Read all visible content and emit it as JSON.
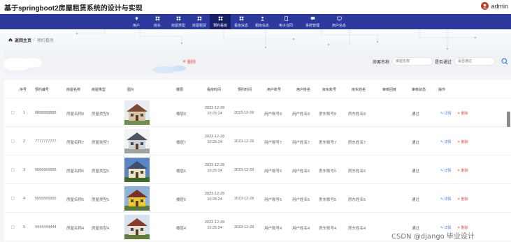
{
  "app": {
    "title": "基于springboot2房屋租赁系统的设计与实现",
    "user": "admin"
  },
  "nav": {
    "items": [
      {
        "label": "用户",
        "icon": "user-icon"
      },
      {
        "label": "房东",
        "icon": "grid-icon"
      },
      {
        "label": "房屋类型",
        "icon": "grid-icon"
      },
      {
        "label": "房屋租赁",
        "icon": "grid-icon"
      },
      {
        "label": "预约看房",
        "icon": "grid-icon",
        "active": true
      },
      {
        "label": "看房信息",
        "icon": "grid-icon"
      },
      {
        "label": "租房信息",
        "icon": "person-icon"
      },
      {
        "label": "电子合同",
        "icon": "doc-icon"
      },
      {
        "label": "系统管理",
        "icon": "chat-icon"
      },
      {
        "label": "用户信息",
        "icon": "monitor-icon"
      }
    ]
  },
  "breadcrumb": {
    "home": "返回主页",
    "current": "预约看房"
  },
  "toolbar": {
    "delete_label": "删除"
  },
  "filters": [
    {
      "label": "房屋名称",
      "placeholder": "房屋名称"
    },
    {
      "label": "是否通过",
      "placeholder": "是否通过"
    }
  ],
  "table": {
    "columns": [
      "序号",
      "预约编号",
      "房屋名称",
      "房屋类型",
      "图片",
      "楼层",
      "看房时间",
      "预约时间",
      "用户账号",
      "用户姓名",
      "房东账号",
      "房东姓名",
      "审核回复",
      "审核状态",
      "操作"
    ],
    "actions": {
      "detail": "详情",
      "delete": "删除"
    },
    "rows": [
      {
        "index": "1",
        "code": "8888888888",
        "name": "房屋名称8",
        "type": "房屋类型8",
        "floor": "楼层8",
        "date": "2023-12-28",
        "time": "10:25:24",
        "booked": "2023-12-28",
        "account": "用户账号8",
        "username": "用户姓名8",
        "landlord_account": "房东账号8",
        "landlord_name": "房东姓名8",
        "reply": "",
        "status": "通过"
      },
      {
        "index": "2",
        "code": "7777777777",
        "name": "房屋名称7",
        "type": "房屋类型7",
        "floor": "楼层7",
        "date": "2023-12-28",
        "time": "10:25:24",
        "booked": "2023-12-28",
        "account": "用户账号7",
        "username": "用户姓名7",
        "landlord_account": "房东账号7",
        "landlord_name": "房东姓名7",
        "reply": "",
        "status": "通过"
      },
      {
        "index": "3",
        "code": "6666666666",
        "name": "房屋名称6",
        "type": "房屋类型6",
        "floor": "楼层6",
        "date": "2023-12-28",
        "time": "10:25:24",
        "booked": "2023-12-28",
        "account": "用户账号6",
        "username": "用户姓名6",
        "landlord_account": "房东账号6",
        "landlord_name": "房东姓名6",
        "reply": "",
        "status": "通过"
      },
      {
        "index": "4",
        "code": "5555555555",
        "name": "房屋名称5",
        "type": "房屋类型5",
        "floor": "楼层5",
        "date": "2023-12-28",
        "time": "10:25:24",
        "booked": "2023-12-28",
        "account": "用户账号5",
        "username": "用户姓名5",
        "landlord_account": "房东账号5",
        "landlord_name": "房东姓名5",
        "reply": "",
        "status": "通过"
      },
      {
        "index": "5",
        "code": "4444444444",
        "name": "房屋名称4",
        "type": "房屋类型4",
        "floor": "楼层4",
        "date": "2023-12-28",
        "time": "10:25:24",
        "booked": "2023-12-28",
        "account": "用户账号4",
        "username": "用户姓名4",
        "landlord_account": "房东账号4",
        "landlord_name": "房东姓名4",
        "reply": "",
        "status": "通过"
      }
    ]
  },
  "watermark": "CSDN @django 毕业设计",
  "colors": {
    "nav": "#2c3a9e",
    "nav_active": "#171f66",
    "link": "#3c7de0",
    "danger": "#e24f4f"
  }
}
